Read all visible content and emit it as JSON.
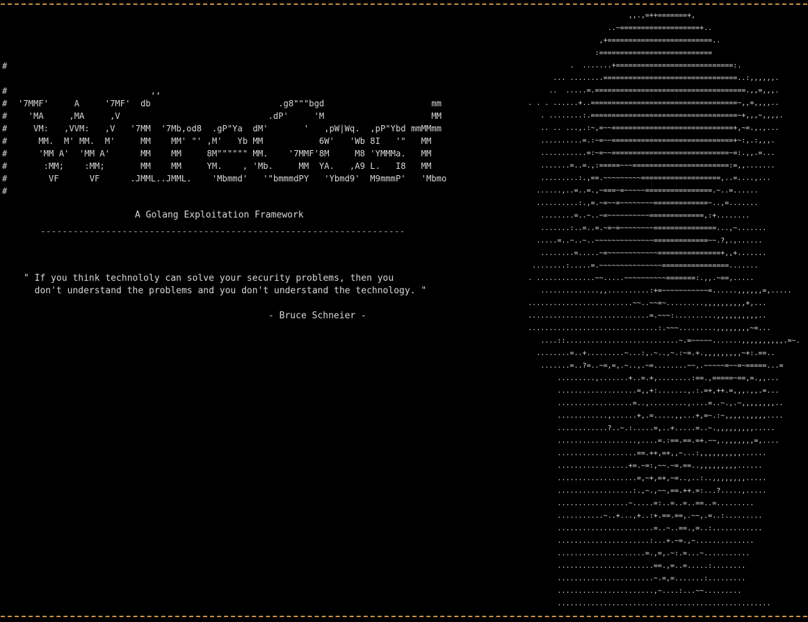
{
  "terminal": {
    "accent_color": "#c9904a",
    "background_color": "#000000",
    "text_color": "#d8d8d8"
  },
  "banner": {
    "hash_column": "#\n\n#\n#\n#\n#\n#\n#\n#\n#\n#",
    "art": "                          ,,\n'7MMF'     A     '7MF'  db                         .g8\"\"\"bgd                     mm\n  'MA     ,MA     ,V                             .dP'     'M                     MM\n   VM:   ,VVM:   ,V   '7MM  '7Mb,od8  .gP\"Ya  dM'       '   ,pW|Wq.  ,pP\"Ybd mmMMmm\n    MM.  M' MM.  M'     MM    MM' \"' ,M'   Yb MM           6W'   'Wb 8I   '\"   MM\n    'MM A'  'MM A'      MM    MM     8M\"\"\"\"\"\" MM.    '7MMF'8M     M8 'YMMMa.   MM\n     :MM;    :MM;       MM    MM     YM.    , 'Mb.     MM  YA.   ,A9 L.   I8   MM\n      VF      VF      .JMML..JMML.    'Mbmmd'   '\"bmmmdPY   'Ybmd9'  M9mmmP'   'Mbmo"
  },
  "subtitle": "A Golang Exploitation Framework",
  "divider": "-------------------------------------------------------------------",
  "quote": {
    "text": "\" If you think technololy can solve your security problems, then you\n  don't understand the problems and you don't understand the technology. \"",
    "author": "- Bruce Schneier -"
  },
  "portrait": {
    "art": "                                      ,,.,=++=======+,\n                                 ..~===================+..\n                               ,+=========================..\n                              :===========================\n                        .  .......+============================:.\n                    ... ........================================..:,,,,,,.\n                   ..  .....=.====================================.,,=,,,.\n              . . . ......+..===================================~,,=,,,,..\n                 . ........:.===================================~+,,,~,,,,.\n                 .. .. ...,.:~,=~~=============================+,~=.,.,...\n                 ..........=.:~=~~=============================+~:,.:,,,.\n                 ...........=:~=~~============================~=:.,,.=...\n                 .......=..=.,:=====~~~=======================:=,,.......\n                 .........:.,==.~~~~~~~~~===================,..=....,...\n                ......,..=..=.,~===~=~~~~~================.~..=......\n                ..........:.,=.~=~~=~~~~~~~~=============~..,=.......\n                 ........=..~..~=~~~~~~~~~~=============,:+........\n                 .......:..=..=.~=~=~~~~~~~~===============...,~.......\n                .....=..~..~..~~~~~~~~~~~~~~=============~~.?,.,......\n                 ........=.....~=~~~~~~~~~~~~===============+,,+.......\n               ........:.....=.~~~~~~~~~~~~~~~================.......\n              . ..............~~.....~~~~~~~~~~=======:.,,.~==,.....\n                 ..............,,..........:+=~~~~~~~~~~~=......,,,,,,=,.....\n              .........................~~..~~=~.........,,,,,,,,,,+,...\n              .............................=.~~~:..........,,,,,,,,,,..\n              ...............................:.~~~.........,,,,,,,,~=...\n                 ....::...........................~.=~~~~~.......,,,,,,,,,,.=~.\n                ........=..+.........~...:,.~..,~.:~=.+.,,,,,,,,,~+:.==..\n                 .......=..?=..~=,=,.~..,.~=........~~,.~~~~~=~~=~=====...=\n                     .........,.......+..=.+,........:==.,=====~==,=.,,...\n                     ...................=,,+:.......,.:.=+,++.=,,,.,,.=...\n                     ..................=..,.........,....=..~.,.~,,,,,,,,..\n                     ............,......+,.=.....,,...+,=~.:~,,,,.,,,,,....\n                     ............?..~.:.....=,..+.....=..~.,,,,,,,,,.....\n                     ...................,....=.:==.==.=+.~~,.,,,,,,,=,....\n                     ...................==.++,=+,,~...:,,,,,,,,,,......\n                     .................+=.~=:,~~.~=.==..,,,,,,,,,......\n                     ...................=,~+,=+,~=..,..:..,,,,,,,,.....\n                     ..................:.,~.,~~,==.++.=:...?.....,.....\n                     .................~.....=:..=..=..==..=.........\n                     ...........~..+...,+..:+.==.==,.~~,.=..:.........\n                     .......................=..~..==.,=..:............\n                     ......................:...+.~=.,~..............\n                     .....................=.,=,.~:.=...~...........\n                     .......................==.,=..=.....:........\n                     .......................~.=,=.......:.........\n                     .......................,~....:...~~.........\n                     ..................................................."
  }
}
